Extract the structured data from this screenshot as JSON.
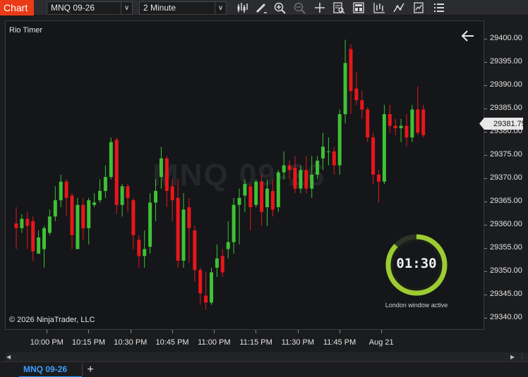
{
  "toolbar": {
    "chart_tab_label": "Chart",
    "instrument_value": "MNQ 09-26",
    "interval_value": "2 Minute",
    "tools": [
      "bar-type-icon",
      "drawing-tool-icon",
      "zoom-in-icon",
      "zoom-out-icon",
      "crosshair-icon",
      "data-box-icon",
      "chart-trader-icon",
      "strategies-icon",
      "indicators-icon",
      "properties-icon",
      "list-icon"
    ]
  },
  "chart": {
    "indicator_label": "Rio Timer",
    "watermark": "MNQ 09-26",
    "copyright": "© 2026 NinjaTrader, LLC",
    "last_price_label": "29381.75",
    "timer": {
      "value": "01:30",
      "caption": "London window active",
      "progress": 0.87,
      "ring_color": "#9ccc32"
    }
  },
  "colors": {
    "up": "#3fc135",
    "down": "#e8161b",
    "background": "#141619"
  },
  "chart_data": {
    "type": "candlestick",
    "price_ticks": [
      "29400.00",
      "29395.00",
      "29390.00",
      "29385.00",
      "29380.00",
      "29375.00",
      "29370.00",
      "29365.00",
      "29360.00",
      "29355.00",
      "29350.00",
      "29345.00",
      "29340.00"
    ],
    "time_ticks": [
      "10:00 PM",
      "10:15 PM",
      "10:30 PM",
      "10:45 PM",
      "11:00 PM",
      "11:15 PM",
      "11:30 PM",
      "11:45 PM",
      "Aug 21"
    ],
    "ylim": [
      29337.5,
      29404
    ],
    "last_price": 29381.75,
    "bars": [
      [
        29360.5,
        29364,
        29355,
        29359.5
      ],
      [
        29359.5,
        29362.5,
        29358.5,
        29361.5
      ],
      [
        29361.5,
        29363,
        29355,
        29360
      ],
      [
        29361,
        29362,
        29352.5,
        29354.5
      ],
      [
        29354,
        29359,
        29354,
        29357.5
      ],
      [
        29355,
        29360,
        29351,
        29359.5
      ],
      [
        29358.5,
        29363.5,
        29358,
        29362
      ],
      [
        29362,
        29368.5,
        29361,
        29365.5
      ],
      [
        29365.5,
        29371,
        29364,
        29369.5
      ],
      [
        29369.5,
        29370,
        29362,
        29366
      ],
      [
        29366.5,
        29367,
        29355,
        29358
      ],
      [
        29355,
        29366,
        29355,
        29364.5
      ],
      [
        29364.5,
        29366,
        29357,
        29359.5
      ],
      [
        29359.5,
        29366,
        29356,
        29365.5
      ],
      [
        29364.5,
        29367,
        29364,
        29365
      ],
      [
        29365.5,
        29370,
        29365,
        29367.5
      ],
      [
        29367.5,
        29373,
        29366,
        29370.5
      ],
      [
        29370.5,
        29379,
        29370,
        29378
      ],
      [
        29378.5,
        29379,
        29362.5,
        29364.5
      ],
      [
        29364.5,
        29369,
        29362,
        29368.5
      ],
      [
        29368.5,
        29369,
        29363,
        29366
      ],
      [
        29365.5,
        29366,
        29355,
        29358
      ],
      [
        29357,
        29358,
        29351,
        29353.5
      ],
      [
        29353.5,
        29359,
        29351,
        29355
      ],
      [
        29355.5,
        29367,
        29354,
        29365
      ],
      [
        29365,
        29370,
        29361,
        29367.5
      ],
      [
        29370.5,
        29377,
        29368,
        29374.5
      ],
      [
        29374.5,
        29375,
        29364,
        29367.5
      ],
      [
        29368.5,
        29370,
        29361,
        29365.5
      ],
      [
        29366,
        29370,
        29351,
        29352.5
      ],
      [
        29352.5,
        29367,
        29351,
        29363.5
      ],
      [
        29364,
        29366,
        29352,
        29359.5
      ],
      [
        29359,
        29360,
        29348,
        29350.5
      ],
      [
        29350.5,
        29351,
        29343,
        29345.5
      ],
      [
        29345,
        29350,
        29342,
        29343.5
      ],
      [
        29343.5,
        29351,
        29343,
        29350
      ],
      [
        29351,
        29356,
        29349,
        29353
      ],
      [
        29353.5,
        29355,
        29349,
        29350
      ],
      [
        29355,
        29361,
        29353,
        29356.5
      ],
      [
        29356.5,
        29366,
        29354,
        29364.5
      ],
      [
        29364.5,
        29368,
        29356,
        29366
      ],
      [
        29366.5,
        29370,
        29363,
        29369
      ],
      [
        29368.5,
        29369,
        29359,
        29364
      ],
      [
        29364.5,
        29370,
        29364,
        29369.5
      ],
      [
        29369.5,
        29371,
        29360,
        29363
      ],
      [
        29364,
        29370,
        29360,
        29368
      ],
      [
        29367.5,
        29370,
        29362,
        29363.5
      ],
      [
        29364,
        29372,
        29363,
        29371.5
      ],
      [
        29371.5,
        29376,
        29370,
        29373
      ],
      [
        29373,
        29374,
        29370,
        29372
      ],
      [
        29372.5,
        29375,
        29367,
        29368
      ],
      [
        29368,
        29373,
        29367,
        29372
      ],
      [
        29372,
        29375,
        29367,
        29368
      ],
      [
        29368,
        29375,
        29366,
        29371
      ],
      [
        29371,
        29375,
        29370,
        29374
      ],
      [
        29374.5,
        29380,
        29372,
        29377
      ],
      [
        29376,
        29379,
        29373,
        29376
      ],
      [
        29376,
        29377,
        29371,
        29373
      ],
      [
        29373,
        29385,
        29371,
        29384
      ],
      [
        29384,
        29400,
        29382,
        29395
      ],
      [
        29398,
        29399,
        29384,
        29389
      ],
      [
        29389.5,
        29393,
        29386,
        29387
      ],
      [
        29387,
        29389,
        29383,
        29385
      ],
      [
        29385,
        29385.5,
        29378,
        29379
      ],
      [
        29379,
        29380,
        29369,
        29371
      ],
      [
        29371,
        29372,
        29365,
        29369.5
      ],
      [
        29369.5,
        29386,
        29369,
        29384
      ],
      [
        29384,
        29386,
        29380,
        29381.5
      ],
      [
        29381.5,
        29383,
        29379.5,
        29381
      ],
      [
        29381,
        29383,
        29378,
        29381.5
      ],
      [
        29381.5,
        29384,
        29377,
        29379
      ],
      [
        29379,
        29386,
        29378,
        29385
      ],
      [
        29385,
        29390,
        29379.5,
        29380
      ],
      [
        29385,
        29386,
        29379,
        29379.5
      ]
    ]
  },
  "tabs": {
    "active": "MNQ 09-26",
    "add": "+"
  }
}
